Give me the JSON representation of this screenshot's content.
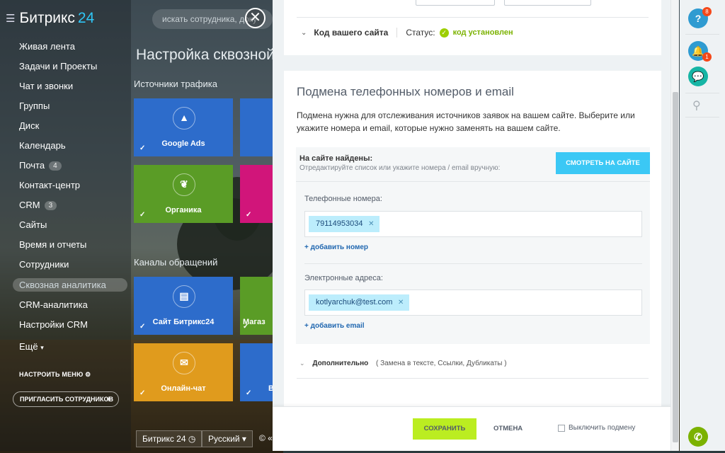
{
  "left_nav": {
    "logo_text": "Битрикс",
    "logo_num": "24",
    "items": [
      {
        "label": "Живая лента"
      },
      {
        "label": "Задачи и Проекты"
      },
      {
        "label": "Чат и звонки"
      },
      {
        "label": "Группы"
      },
      {
        "label": "Диск"
      },
      {
        "label": "Календарь"
      },
      {
        "label": "Почта",
        "count": "4"
      },
      {
        "label": "Контакт-центр"
      },
      {
        "label": "CRM",
        "count": "3"
      },
      {
        "label": "Сайты"
      },
      {
        "label": "Время и отчеты"
      },
      {
        "label": "Сотрудники"
      },
      {
        "label": "Сквозная аналитика"
      },
      {
        "label": "CRM-аналитика"
      },
      {
        "label": "Настройки CRM"
      },
      {
        "label": "Ещё"
      }
    ],
    "setup_menu": "НАСТРОИТЬ МЕНЮ",
    "invite": "ПРИГЛАСИТЬ СОТРУДНИКОВ"
  },
  "search": {
    "placeholder": "искать сотрудника, доку"
  },
  "background_page": {
    "title": "Настройка сквозной",
    "traffic_heading": "Источники трафика",
    "channels_heading": "Каналы обращений",
    "tiles": [
      {
        "label": "Google Ads",
        "color": "#2d6ccb"
      },
      {
        "label": "Органика",
        "color": "#5a9c26"
      },
      {
        "label": "Сайт Битрикс24",
        "color": "#2d6ccb"
      },
      {
        "label": "Магаз",
        "color": "#5a9c26"
      },
      {
        "label": "Онлайн-чат",
        "color": "#e09b1d"
      },
      {
        "label": "В",
        "color": "#2d6ccb"
      }
    ],
    "footer": {
      "brand": "Битрикс 24",
      "lang": "Русский",
      "copyright": "© «Б"
    }
  },
  "site_code": {
    "label": "Код вашего сайта",
    "status_label": "Статус:",
    "status_value": "код установлен"
  },
  "phone_email": {
    "title": "Подмена телефонных номеров и email",
    "description": "Подмена нужна для отслеживания источников заявок на вашем сайте. Выберите или укажите номера и email, которые нужно заменять на вашем сайте.",
    "found_title": "На сайте найдены:",
    "found_hint": "Отредактируйте список или укажите номера / email вручную:",
    "look_button": "СМОТРЕТЬ НА САЙТЕ",
    "phones_label": "Телефонные номера:",
    "phones": [
      "79114953034"
    ],
    "add_phone": "+ добавить номер",
    "emails_label": "Электронные адреса:",
    "emails": [
      "kotlyarchuk@test.com"
    ],
    "add_email": "+ добавить email",
    "extra_label": "Дополнительно",
    "extra_hint": "( Замена в тексте,  Ссылки,  Дубликаты )"
  },
  "footer": {
    "save": "СОХРАНИТЬ",
    "cancel": "ОТМЕНА",
    "disable_label": "Выключить подмену"
  },
  "right_bar": {
    "help_badge": "8",
    "notif_badge": "1"
  },
  "colors": {
    "accent": "#3bc8f5",
    "save": "#bbed21",
    "ok": "#9dcf00",
    "link": "#2067b0"
  }
}
